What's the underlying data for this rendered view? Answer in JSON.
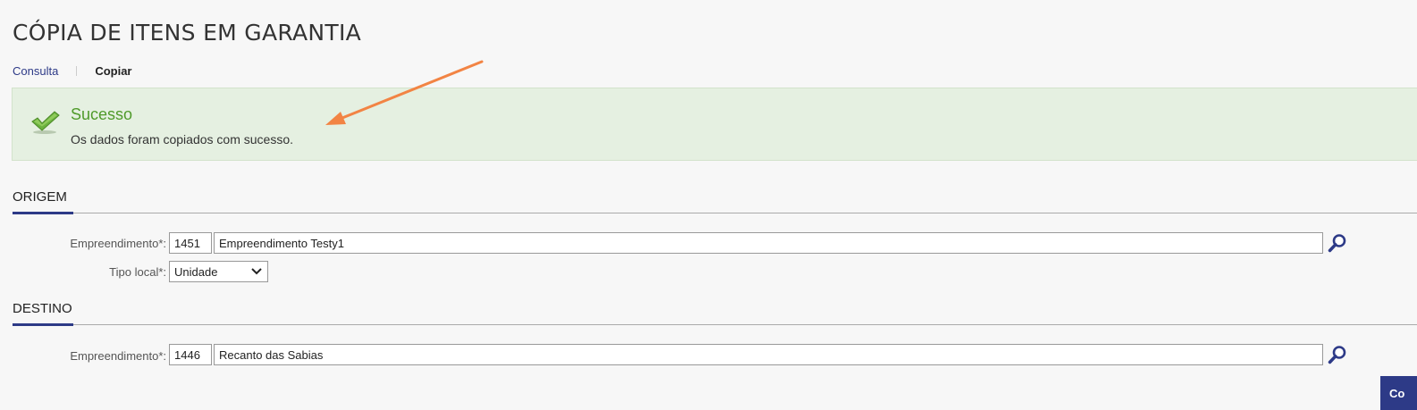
{
  "page": {
    "title": "CÓPIA DE ITENS EM GARANTIA"
  },
  "breadcrumb": {
    "link": "Consulta",
    "current": "Copiar"
  },
  "alert": {
    "title": "Sucesso",
    "message": "Os dados foram copiados com sucesso.",
    "icon": "check-icon",
    "title_color": "#4f9a2a",
    "background": "#e5f0e1"
  },
  "origem": {
    "title": "ORIGEM",
    "empreendimento_label": "Empreendimento*:",
    "empreendimento_code": "1451",
    "empreendimento_name": "Empreendimento Testy1",
    "tipo_local_label": "Tipo local*:",
    "tipo_local_value": "Unidade"
  },
  "destino": {
    "title": "DESTINO",
    "empreendimento_label": "Empreendimento*:",
    "empreendimento_code": "1446",
    "empreendimento_name": "Recanto das Sabias"
  },
  "actions": {
    "button_label": "Co"
  },
  "theme": {
    "accent": "#2d3a87",
    "annotation_arrow": "#f28444"
  }
}
